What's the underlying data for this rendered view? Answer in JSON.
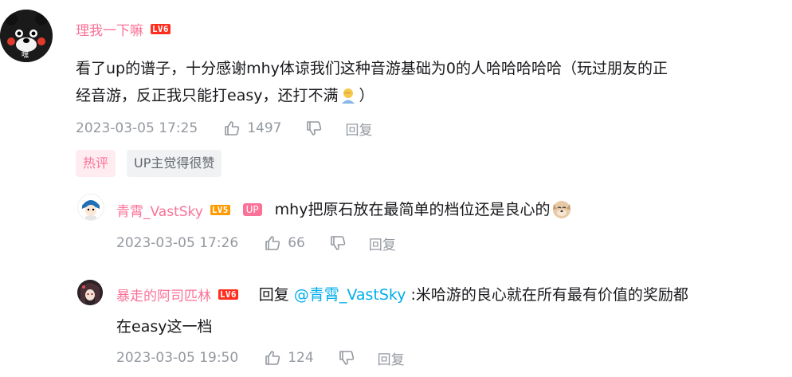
{
  "comment": {
    "username": "理我一下嘛",
    "level": "LV6",
    "text": "看了up的谱子，十分感谢mhy体谅我们这种音游基础为0的人哈哈哈哈哈（玩过朋友的正经音游，反正我只能打easy，还打不满🤦‍♂️）",
    "line1": "看了up的谱子，十分感谢mhy体谅我们这种音游基础为0的人哈哈哈哈哈（玩过朋友的正",
    "line2": "经音游，反正我只能打easy，还打不满",
    "line2_end": "）",
    "timestamp": "2023-03-05 17:25",
    "likes": "1497",
    "reply_label": "回复",
    "tags": [
      "热评",
      "UP主觉得很赞"
    ]
  },
  "replies": [
    {
      "username": "青霄_VastSky",
      "level": "LV5",
      "up_badge": "UP",
      "text": "mhy把原石放在最简单的档位还是良心的",
      "timestamp": "2023-03-05 17:26",
      "likes": "66",
      "reply_label": "回复"
    },
    {
      "username": "暴走的阿司匹林",
      "level": "LV6",
      "reply_prefix": "回复 ",
      "mention": "@青霄_VastSky",
      "text_line1": " :米哈游的良心就在所有最有价值的奖励都",
      "text_line2": "在easy这一档",
      "timestamp": "2023-03-05 19:50",
      "likes": "124",
      "reply_label": "回复"
    }
  ],
  "avatar_texts": {
    "kumamon": "嘿"
  },
  "colors": {
    "accent": "#fb7299",
    "meta": "#9499a0",
    "mention": "#00aeec",
    "lv6": "#ff2e1f",
    "lv5": "#ff9a00"
  }
}
